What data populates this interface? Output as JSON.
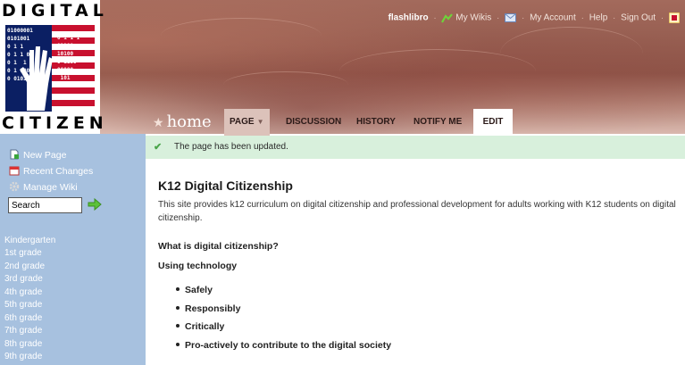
{
  "logo": {
    "word_top": "DIGITAL",
    "word_bottom": "CITIZEN",
    "binary_left": "01000001\n0101001\n0 1 1\n0 1 1 0\n0 1  1\n0 1 100\n0 0101",
    "binary_right": "0 1 1 1\n01100\n10100\n0 1100\n00000\n 101\n 000"
  },
  "top_nav": {
    "username": "flashlibro",
    "my_wikis": "My Wikis",
    "my_account": "My Account",
    "help": "Help",
    "sign_out": "Sign Out"
  },
  "tabs": {
    "home": "home",
    "page": "PAGE",
    "discussion": "DISCUSSION",
    "history": "HISTORY",
    "notify_me": "NOTIFY ME",
    "edit": "EDIT"
  },
  "sidebar": {
    "new_page": "New Page",
    "recent_changes": "Recent Changes",
    "manage_wiki": "Manage Wiki",
    "search_value": "Search",
    "grades": [
      "Kindergarten",
      "1st grade",
      "2nd grade",
      "3rd grade",
      "4th grade",
      "5th grade",
      "6th grade",
      "7th grade",
      "8th grade",
      "9th grade"
    ]
  },
  "notice": {
    "message": "The page has been updated."
  },
  "content": {
    "title": "K12 Digital Citizenship",
    "intro": "This site provides k12 curriculum on digital citizenship and professional development for adults working with K12 students on digital citizenship.",
    "question": "What is digital citizenship?",
    "using": "Using technology",
    "bullets": [
      "Safely",
      "Responsibly",
      "Critically",
      "Pro-actively to contribute to the digital society"
    ]
  },
  "colors": {
    "sidebar": "#a7c1df",
    "notice": "#d8f0dc",
    "header": "#8c5448"
  }
}
